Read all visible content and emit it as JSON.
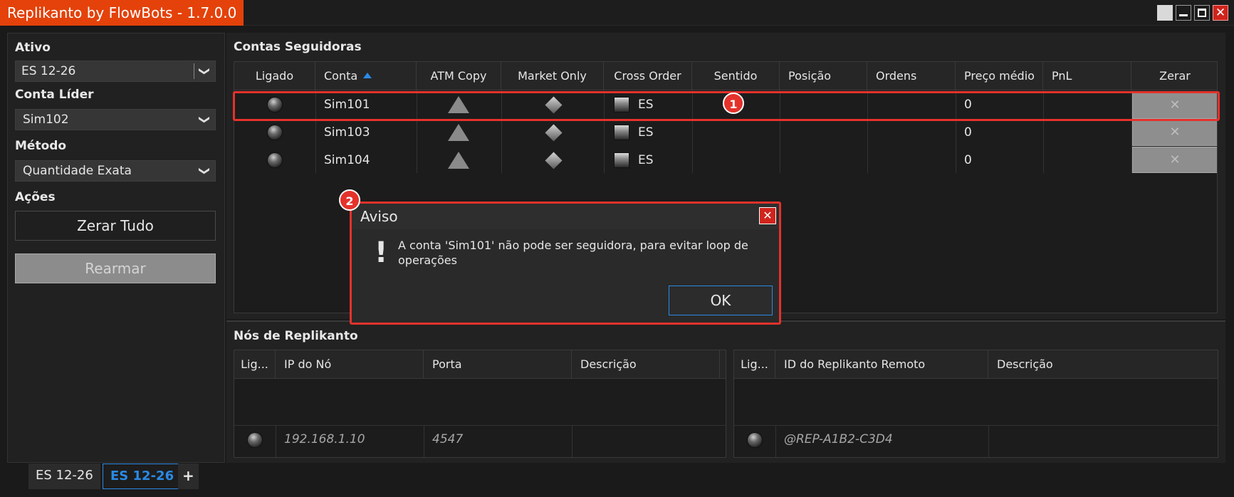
{
  "window": {
    "title": "Replikanto by FlowBots - 1.7.0.0",
    "close_glyph": "✕"
  },
  "left": {
    "ativo_label": "Ativo",
    "ativo_value": "ES 12-26",
    "conta_lider_label": "Conta Líder",
    "conta_lider_value": "Sim102",
    "metodo_label": "Método",
    "metodo_value": "Quantidade Exata",
    "acoes_label": "Ações",
    "zerar_tudo": "Zerar Tudo",
    "rearmar": "Rearmar",
    "chevron_glyph": "❯"
  },
  "followers": {
    "title": "Contas Seguidoras",
    "columns": [
      "Ligado",
      "Conta",
      "ATM Copy",
      "Market Only",
      "Cross Order",
      "Sentido",
      "Posição",
      "Ordens",
      "Preço médio",
      "PnL",
      "Zerar"
    ],
    "rows": [
      {
        "conta": "Sim101",
        "cross": "ES",
        "sentido": "",
        "posicao": "",
        "ordens": "",
        "preco": "0",
        "pnl": ""
      },
      {
        "conta": "Sim103",
        "cross": "ES",
        "sentido": "",
        "posicao": "",
        "ordens": "",
        "preco": "0",
        "pnl": ""
      },
      {
        "conta": "Sim104",
        "cross": "ES",
        "sentido": "",
        "posicao": "",
        "ordens": "",
        "preco": "0",
        "pnl": ""
      }
    ],
    "zerar_glyph": "✕",
    "sort_icon": "sort-ascending-icon"
  },
  "annotations": {
    "badge1": "1",
    "badge2": "2"
  },
  "dialog": {
    "title": "Aviso",
    "message": "A conta 'Sim101' não pode ser seguidora, para evitar loop de operações",
    "ok": "OK",
    "exclamation": "!",
    "close_glyph": "✕"
  },
  "nodes": {
    "title": "Nós de Replikanto",
    "local_columns": [
      "Lig...",
      "IP do Nó",
      "Porta",
      "Descrição"
    ],
    "local_row": {
      "ip": "192.168.1.10",
      "porta": "4547",
      "descricao": ""
    },
    "remote_columns": [
      "Lig...",
      "ID do Replikanto Remoto",
      "Descrição"
    ],
    "remote_row": {
      "id": "@REP-A1B2-C3D4",
      "descricao": ""
    }
  },
  "tabs": [
    {
      "label": "ES 12-26",
      "active": false
    },
    {
      "label": "ES 12-26",
      "active": true
    }
  ],
  "tab_add": "+",
  "colors": {
    "accent": "#e4420a",
    "highlight": "#e4322b",
    "focus": "#2a8ae6"
  }
}
